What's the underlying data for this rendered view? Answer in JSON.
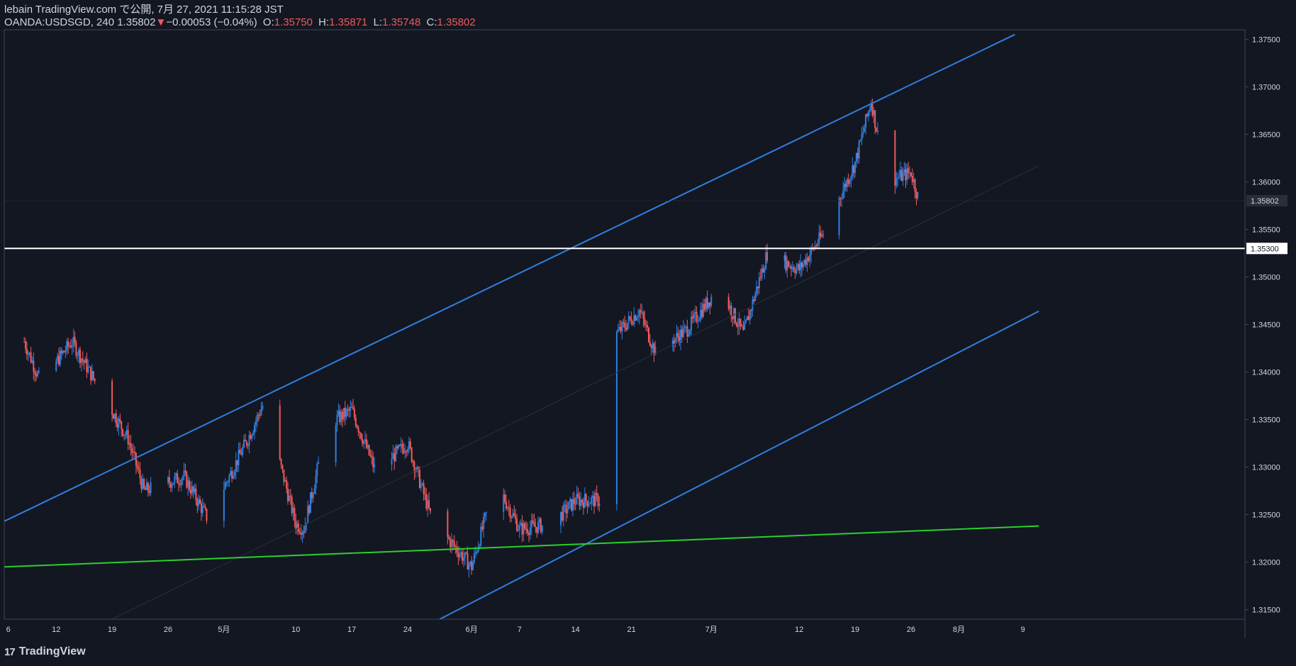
{
  "header": {
    "line1": "lebain TradingView.com で公開, 7月 27, 2021 11:15:28 JST",
    "symbol": "OANDA:USDSGD, 240",
    "last": "1.35802",
    "change": "−0.00053 (−0.04%)",
    "o_label": "O:",
    "o": "1.35750",
    "h_label": "H:",
    "h": "1.35871",
    "l_label": "L:",
    "l": "1.35748",
    "c_label": "C:",
    "c": "1.35802",
    "down_arrow": "▼"
  },
  "footer": {
    "brand": "TradingView",
    "logo_mark": "17"
  },
  "colors": {
    "background": "#131722",
    "up": "#2f7fe0",
    "down": "#f05a5a",
    "channel": "#2f7fe0",
    "support": "#29d12c",
    "level": "#ffffff"
  },
  "chart_data": {
    "type": "candlestick",
    "symbol": "OANDA:USDSGD",
    "timeframe": "240",
    "ylim": [
      1.314,
      1.376
    ],
    "y_ticks": [
      "1.37500",
      "1.37000",
      "1.36500",
      "1.36000",
      "1.35500",
      "1.35000",
      "1.34500",
      "1.34000",
      "1.33500",
      "1.33000",
      "1.32500",
      "1.32000",
      "1.31500"
    ],
    "y_tick_values": [
      1.375,
      1.37,
      1.365,
      1.36,
      1.355,
      1.35,
      1.345,
      1.34,
      1.335,
      1.33,
      1.325,
      1.32,
      1.315
    ],
    "x_range_days": [
      -27.5,
      72.2
    ],
    "x_ticks": [
      {
        "label": "6",
        "day": -27
      },
      {
        "label": "12",
        "day": -21
      },
      {
        "label": "19",
        "day": -14
      },
      {
        "label": "26",
        "day": -7
      },
      {
        "label": "5月",
        "day": 0
      },
      {
        "label": "10",
        "day": 9
      },
      {
        "label": "17",
        "day": 16
      },
      {
        "label": "24",
        "day": 23
      },
      {
        "label": "6月",
        "day": 31
      },
      {
        "label": "7",
        "day": 37
      },
      {
        "label": "14",
        "day": 44
      },
      {
        "label": "21",
        "day": 51
      },
      {
        "label": "7月",
        "day": 61
      },
      {
        "label": "12",
        "day": 72
      },
      {
        "label": "19",
        "day": 79
      },
      {
        "label": "26",
        "day": 86
      },
      {
        "label": "8月",
        "day": 92
      },
      {
        "label": "9",
        "day": 100
      }
    ],
    "current_price": "1.35802",
    "current_value": 1.35802,
    "horizontal_level": "1.35300",
    "horizontal_level_value": 1.353,
    "key_points": [
      {
        "label": "Apr 6",
        "y": 1.3432
      },
      {
        "label": "Apr 8",
        "y": 1.339
      },
      {
        "label": "Apr 12",
        "y": 1.3432
      },
      {
        "label": "Apr 19",
        "y": 1.333
      },
      {
        "label": "Apr 21",
        "y": 1.3275
      },
      {
        "label": "Apr 26",
        "y": 1.329
      },
      {
        "label": "Apr 29",
        "y": 1.3245
      },
      {
        "label": "May 4",
        "y": 1.333
      },
      {
        "label": "May 6",
        "y": 1.3368
      },
      {
        "label": "May 10",
        "y": 1.324
      },
      {
        "label": "May 11",
        "y": 1.3235
      },
      {
        "label": "May 14",
        "y": 1.3345
      },
      {
        "label": "May 17",
        "y": 1.336
      },
      {
        "label": "May 20",
        "y": 1.3295
      },
      {
        "label": "May 24",
        "y": 1.3325
      },
      {
        "label": "May 27",
        "y": 1.3245
      },
      {
        "label": "Jun 1",
        "y": 1.3195
      },
      {
        "label": "Jun 4",
        "y": 1.3285
      },
      {
        "label": "Jun 7",
        "y": 1.3235
      },
      {
        "label": "Jun 11",
        "y": 1.324
      },
      {
        "label": "Jun 14",
        "y": 1.3265
      },
      {
        "label": "Jun 17",
        "y": 1.3265
      },
      {
        "label": "Jun 18",
        "y": 1.343
      },
      {
        "label": "Jun 22",
        "y": 1.3465
      },
      {
        "label": "Jun 24",
        "y": 1.342
      },
      {
        "label": "Jun 28",
        "y": 1.3445
      },
      {
        "label": "Jul 2",
        "y": 1.349
      },
      {
        "label": "Jul 5",
        "y": 1.344
      },
      {
        "label": "Jul 8",
        "y": 1.3525
      },
      {
        "label": "Jul 12",
        "y": 1.3508
      },
      {
        "label": "Jul 15",
        "y": 1.3545
      },
      {
        "label": "Jul 19",
        "y": 1.362
      },
      {
        "label": "Jul 21",
        "y": 1.3685
      },
      {
        "label": "Jul 23",
        "y": 1.36
      },
      {
        "label": "Jul 26",
        "y": 1.361
      },
      {
        "label": "Jul 27",
        "y": 1.358
      }
    ],
    "channel_upper": [
      {
        "day": -27.5,
        "y": 1.3243
      },
      {
        "day": 99,
        "y": 1.3755
      }
    ],
    "channel_lower": [
      {
        "day": 27,
        "y": 1.314
      },
      {
        "day": 102,
        "y": 1.3464
      }
    ],
    "channel_mid": [
      {
        "day": -14,
        "y": 1.314
      },
      {
        "day": 102,
        "y": 1.3617
      }
    ],
    "support_line": [
      {
        "day": -27.5,
        "y": 1.3195
      },
      {
        "day": 102,
        "y": 1.3238
      }
    ]
  }
}
